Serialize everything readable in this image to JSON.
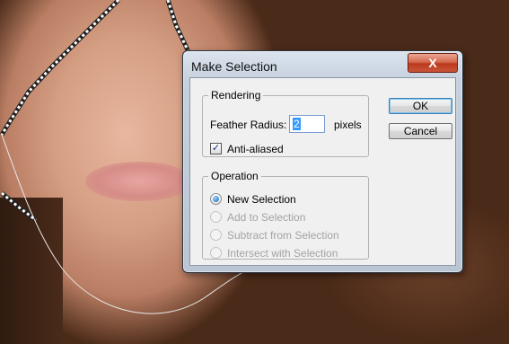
{
  "dialog": {
    "title": "Make Selection",
    "close_label": "X",
    "buttons": {
      "ok": "OK",
      "cancel": "Cancel"
    }
  },
  "rendering": {
    "legend": "Rendering",
    "feather_label": "Feather Radius:",
    "feather_value": "2",
    "feather_unit": "pixels",
    "antialiased_label": "Anti-aliased",
    "antialiased_checked": true
  },
  "operation": {
    "legend": "Operation",
    "options": [
      {
        "label": "New Selection",
        "selected": true,
        "enabled": true
      },
      {
        "label": "Add to Selection",
        "selected": false,
        "enabled": false
      },
      {
        "label": "Subtract from Selection",
        "selected": false,
        "enabled": false
      },
      {
        "label": "Intersect with Selection",
        "selected": false,
        "enabled": false
      }
    ]
  },
  "colors": {
    "skin": "#d49e83",
    "lips": "#d68c87",
    "hair": "#4a2a18",
    "close_button": "#c9553a",
    "dialog_frame": "#c6d1de"
  }
}
